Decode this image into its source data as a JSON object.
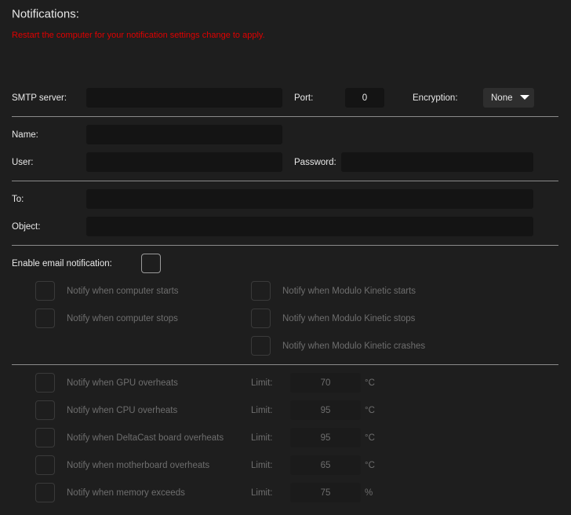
{
  "title": "Notifications:",
  "warning": "Restart the computer for your notification settings change to apply.",
  "colors": {
    "warning": "#e00000",
    "background": "#1e1e1e"
  },
  "smtp": {
    "label": "SMTP server:",
    "value": "",
    "port_label": "Port:",
    "port_value": "0",
    "encryption_label": "Encryption:",
    "encryption_value": "None"
  },
  "name": {
    "label": "Name:",
    "value": ""
  },
  "user": {
    "label": "User:",
    "value": ""
  },
  "password": {
    "label": "Password:",
    "value": ""
  },
  "to": {
    "label": "To:",
    "value": ""
  },
  "object": {
    "label": "Object:",
    "value": ""
  },
  "enable": {
    "label": "Enable email notification:",
    "checked": false
  },
  "events_left": [
    {
      "label": "Notify when computer starts"
    },
    {
      "label": "Notify when computer stops"
    }
  ],
  "events_right": [
    {
      "label": "Notify when Modulo Kinetic starts"
    },
    {
      "label": "Notify when Modulo Kinetic stops"
    },
    {
      "label": "Notify when Modulo Kinetic crashes"
    }
  ],
  "limits": [
    {
      "label": "Notify when GPU overheats",
      "limit_label": "Limit:",
      "value": "70",
      "unit": "°C"
    },
    {
      "label": "Notify when CPU overheats",
      "limit_label": "Limit:",
      "value": "95",
      "unit": "°C"
    },
    {
      "label": "Notify when DeltaCast board overheats",
      "limit_label": "Limit:",
      "value": "95",
      "unit": "°C"
    },
    {
      "label": "Notify when motherboard overheats",
      "limit_label": "Limit:",
      "value": "65",
      "unit": "°C"
    },
    {
      "label": "Notify when memory exceeds",
      "limit_label": "Limit:",
      "value": "75",
      "unit": "%"
    }
  ]
}
